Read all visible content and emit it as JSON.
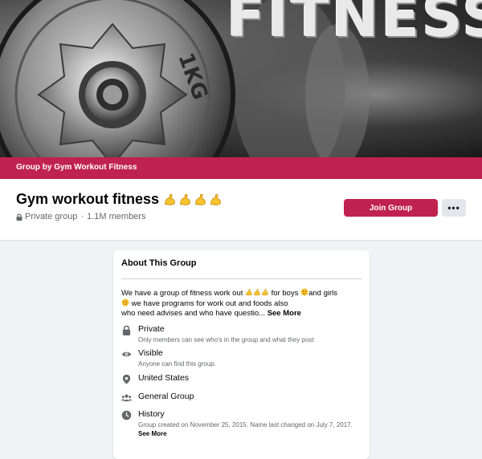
{
  "cover": {
    "word": "FITNESS",
    "plate_letters": "1KG"
  },
  "group_bar": {
    "text": "Group by Gym Workout Fitness"
  },
  "header": {
    "title": "Gym workout fitness",
    "title_emoji": [
      "flexed-biceps-emoji",
      "flexed-biceps-emoji",
      "flexed-biceps-emoji",
      "flexed-biceps-emoji"
    ],
    "privacy": "Private group",
    "members": "1.1M members",
    "separator": "·",
    "join_label": "Join Group",
    "more_label": "•••"
  },
  "about": {
    "title": "About This Group",
    "description_line1": "We have a group of fitness work out",
    "description_line1b": "for boys",
    "description_line1c": "and girls",
    "description_line2": "we have programs for work out and foods also",
    "description_line3": "who need advises and who have questio...",
    "see_more": "See More",
    "items": [
      {
        "icon": "lock-icon",
        "label": "Private",
        "sub": "Only members can see who's in the group and what they post"
      },
      {
        "icon": "eye-icon",
        "label": "Visible",
        "sub": "Anyone can find this group."
      },
      {
        "icon": "location-pin-icon",
        "label": "United States",
        "sub": ""
      },
      {
        "icon": "people-icon",
        "label": "General Group",
        "sub": ""
      },
      {
        "icon": "clock-icon",
        "label": "History",
        "sub": "Group created on November 25, 2015. Name last changed on July 7, 2017.",
        "sub_link": "See More"
      }
    ]
  },
  "colors": {
    "accent": "#c0224f",
    "page_bg": "#f0f2f5",
    "muted_text": "#65676b"
  }
}
